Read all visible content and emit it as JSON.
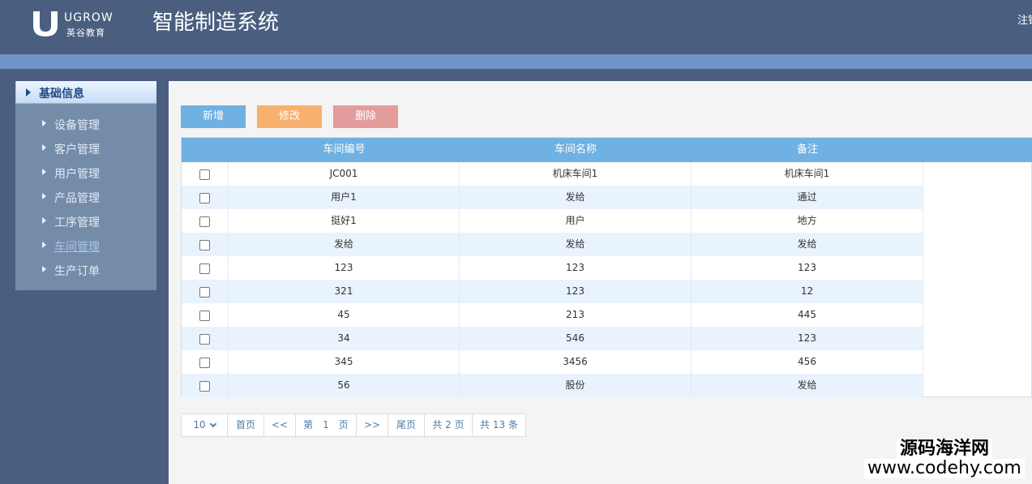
{
  "header": {
    "logo_brand": "UGROW",
    "logo_sub": "英谷教育",
    "title": "智能制造系统",
    "logout_label": "注销"
  },
  "sidebar": {
    "group_label": "基础信息",
    "items": [
      {
        "label": "设备管理"
      },
      {
        "label": "客户管理"
      },
      {
        "label": "用户管理"
      },
      {
        "label": "产品管理"
      },
      {
        "label": "工序管理"
      },
      {
        "label": "车间管理",
        "active": true
      },
      {
        "label": "生产订单"
      }
    ]
  },
  "toolbar": {
    "add_label": "新增",
    "edit_label": "修改",
    "delete_label": "删除"
  },
  "table": {
    "columns": [
      "车间编号",
      "车间名称",
      "备注"
    ],
    "rows": [
      [
        "JC001",
        "机床车间1",
        "机床车间1"
      ],
      [
        "用户1",
        "发给",
        "通过"
      ],
      [
        "挺好1",
        "用户",
        "地方"
      ],
      [
        "发给",
        "发给",
        "发给"
      ],
      [
        "123",
        "123",
        "123"
      ],
      [
        "321",
        "123",
        "12"
      ],
      [
        "45",
        "213",
        "445"
      ],
      [
        "34",
        "546",
        "123"
      ],
      [
        "345",
        "3456",
        "456"
      ],
      [
        "56",
        "股份",
        "发给"
      ]
    ]
  },
  "pager": {
    "page_size": "10",
    "first": "首页",
    "prev": "<<",
    "current": "第　1　页",
    "next": ">>",
    "last": "尾页",
    "total_pages": "共 2 页",
    "total_items": "共 13 条"
  },
  "watermark": {
    "line1": "源码海洋网",
    "line2": "www.codehy.com"
  },
  "colors": {
    "header_bg": "#4a5f80",
    "band": "#6f93c8",
    "table_header": "#6fb1e3",
    "btn_add": "#6fb1e3",
    "btn_edit": "#f7b06e",
    "btn_delete": "#e39b9c"
  }
}
